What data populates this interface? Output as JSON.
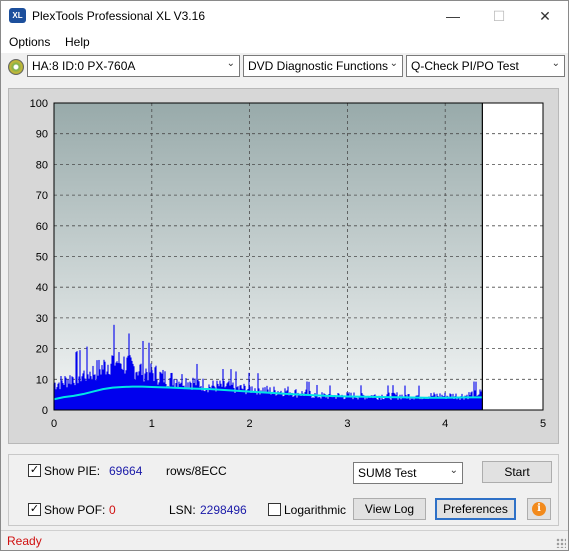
{
  "window": {
    "title": "PlexTools Professional XL V3.16",
    "app_icon_text": "XL",
    "minimize_glyph": "—",
    "maximize_glyph": "☐",
    "close_glyph": "✕"
  },
  "menu": {
    "items": [
      {
        "label": "Options"
      },
      {
        "label": "Help"
      }
    ]
  },
  "toolbar": {
    "drive": "HA:8 ID:0  PX-760A",
    "function": "DVD Diagnostic Functions",
    "test": "Q-Check PI/PO Test"
  },
  "chart_data": {
    "type": "area",
    "title": "",
    "xlabel": "",
    "ylabel": "",
    "xlim": [
      0,
      5
    ],
    "ylim": [
      0,
      100
    ],
    "x_ticks": [
      "0",
      "1",
      "2",
      "3",
      "4",
      "5"
    ],
    "y_ticks": [
      "0",
      "10",
      "20",
      "30",
      "40",
      "50",
      "60",
      "70",
      "80",
      "90",
      "100"
    ],
    "grid": true,
    "end_marker_x": 4.38,
    "colors": {
      "pie_bars": "#0000ee",
      "average_line": "#00e5e5",
      "plot_bg_top": "#98aaaa",
      "plot_bg_bottom": "#f4f6f6",
      "grid": "#4a4a4a"
    },
    "series": [
      {
        "name": "PIE",
        "x": [
          0.0,
          0.1,
          0.2,
          0.3,
          0.4,
          0.5,
          0.6,
          0.7,
          0.8,
          0.9,
          1.0,
          1.1,
          1.2,
          1.3,
          1.4,
          1.5,
          1.6,
          1.7,
          1.8,
          1.9,
          2.0,
          2.1,
          2.2,
          2.3,
          2.4,
          2.5,
          2.6,
          2.7,
          2.8,
          2.9,
          3.0,
          3.1,
          3.2,
          3.3,
          3.4,
          3.5,
          3.6,
          3.7,
          3.8,
          3.9,
          4.0,
          4.1,
          4.2,
          4.3,
          4.38
        ],
        "values": [
          11,
          12,
          14,
          15,
          16,
          18,
          21,
          20,
          18,
          17,
          16,
          14,
          13,
          13,
          12,
          11,
          10,
          10,
          10,
          9,
          9,
          9,
          8,
          8,
          8,
          7,
          7,
          6,
          6,
          6,
          6,
          6,
          6,
          6,
          6,
          6,
          6,
          6,
          6,
          6,
          6,
          6,
          6,
          7,
          7
        ]
      },
      {
        "name": "Average",
        "x": [
          0.0,
          0.1,
          0.2,
          0.3,
          0.4,
          0.5,
          0.6,
          0.7,
          0.8,
          0.9,
          1.0,
          1.2,
          1.4,
          1.6,
          1.8,
          2.0,
          2.2,
          2.4,
          2.6,
          2.8,
          3.0,
          3.2,
          3.4,
          3.6,
          3.8,
          4.0,
          4.2,
          4.38
        ],
        "values": [
          3.5,
          4.2,
          4.6,
          5.2,
          6.0,
          6.8,
          7.3,
          7.5,
          7.6,
          7.6,
          7.5,
          7.3,
          7.0,
          6.8,
          6.4,
          6.0,
          5.6,
          5.2,
          4.9,
          4.6,
          4.4,
          4.3,
          4.2,
          4.1,
          4.0,
          4.0,
          4.1,
          4.1
        ]
      }
    ]
  },
  "controls": {
    "show_pie_label": "Show PIE:",
    "show_pie_checked": "✓",
    "pie_value": "69664",
    "rows_label": "rows/8ECC",
    "show_pof_label": "Show POF:",
    "show_pof_checked": "✓",
    "pof_value": "0",
    "lsn_label": "LSN:",
    "lsn_value": "2298496",
    "logarithmic_label": "Logarithmic",
    "sum_select": "SUM8 Test",
    "start_button": "Start",
    "view_log_button": "View Log",
    "preferences_button": "Preferences",
    "info_glyph": "i"
  },
  "status": {
    "text": "Ready"
  }
}
